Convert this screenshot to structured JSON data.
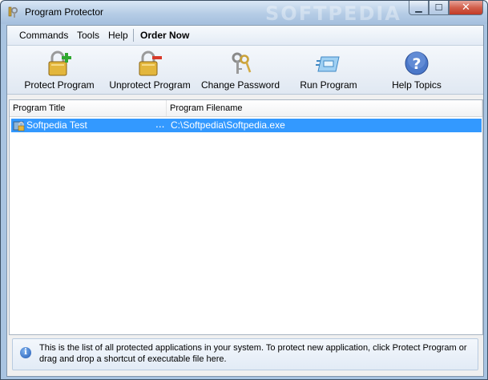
{
  "window": {
    "title": "Program Protector"
  },
  "menu": {
    "items": [
      "Commands",
      "Tools",
      "Help"
    ],
    "order_now": "Order Now"
  },
  "toolbar": {
    "buttons": [
      {
        "label": "Protect Program",
        "icon": "lock-plus-icon"
      },
      {
        "label": "Unprotect Program",
        "icon": "lock-minus-icon"
      },
      {
        "label": "Change Password",
        "icon": "keys-icon"
      },
      {
        "label": "Run Program",
        "icon": "run-program-icon"
      },
      {
        "label": "Help Topics",
        "icon": "help-icon"
      }
    ]
  },
  "list": {
    "columns": [
      "Program Title",
      "Program Filename"
    ],
    "rows": [
      {
        "title": "Softpedia Test",
        "ellipsis": "...",
        "filename": "C:\\Softpedia\\Softpedia.exe",
        "selected": true
      }
    ]
  },
  "info": {
    "text": "This is the list of all protected applications in your system. To protect new application, click Protect Program or drag and drop a shortcut of executable file here."
  },
  "colors": {
    "selection": "#3399ff",
    "title_bar": "#b6cde6",
    "close_button": "#c23a26"
  }
}
